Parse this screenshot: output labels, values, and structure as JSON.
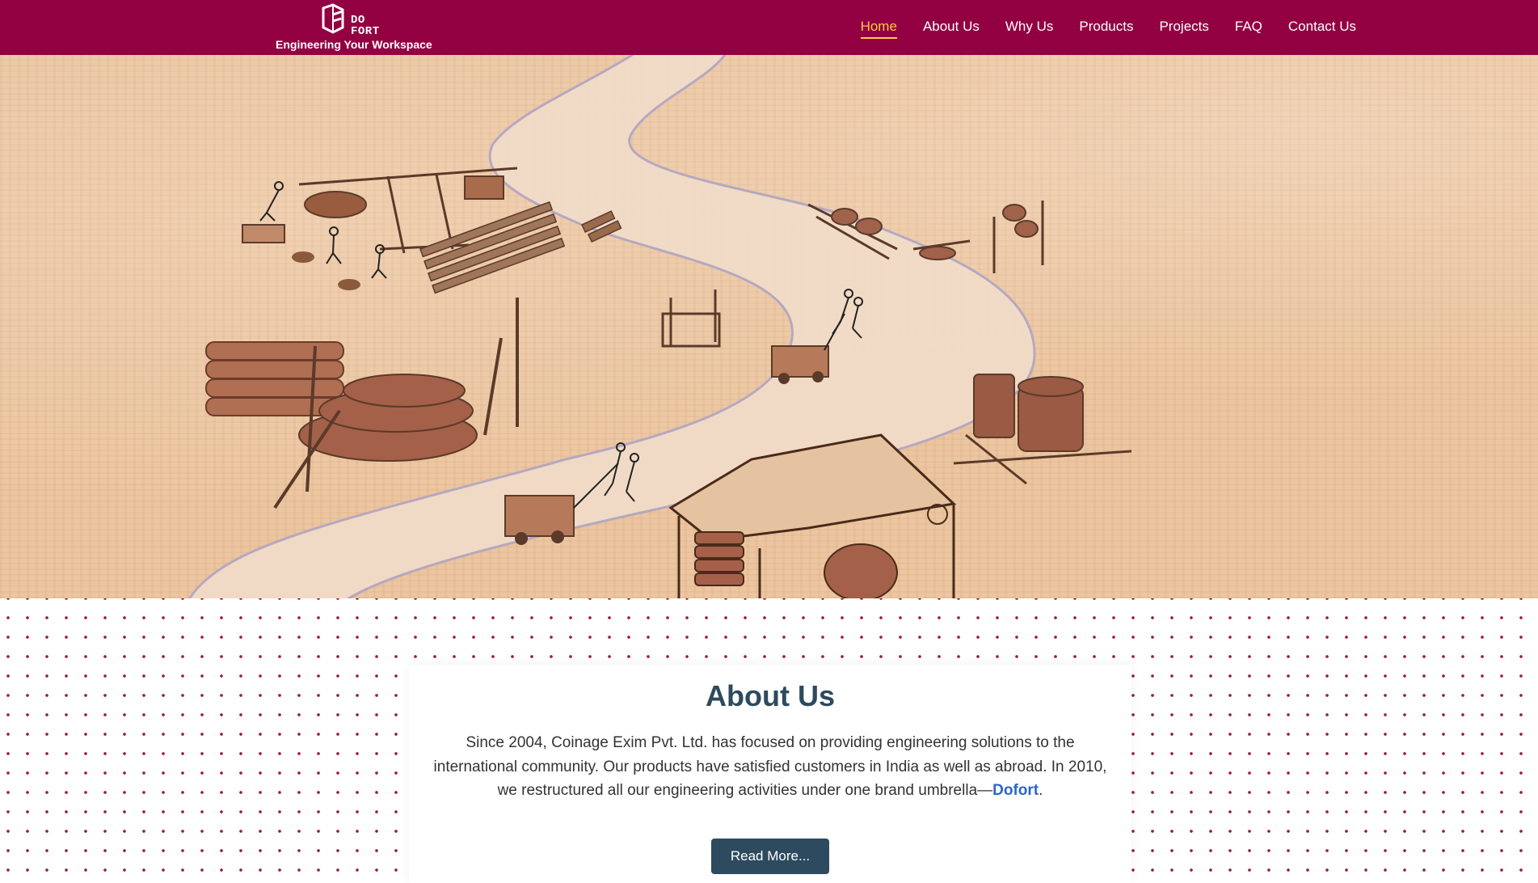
{
  "brand": {
    "logo_word_line1": "DO",
    "logo_word_line2": "FORT",
    "tagline": "Engineering Your Workspace"
  },
  "nav": {
    "items": [
      {
        "label": "Home",
        "active": true
      },
      {
        "label": "About Us",
        "active": false
      },
      {
        "label": "Why Us",
        "active": false
      },
      {
        "label": "Products",
        "active": false
      },
      {
        "label": "Projects",
        "active": false
      },
      {
        "label": "FAQ",
        "active": false
      },
      {
        "label": "Contact Us",
        "active": false
      }
    ]
  },
  "hero": {
    "image_alt": "hero-illustration"
  },
  "about": {
    "title": "About Us",
    "text_before": "Since 2004, Coinage Exim Pvt. Ltd. has focused on providing engineering solutions to the international community. Our products have satisfied customers in India as well as abroad. In 2010, we restructured all our engineering activities under one brand umbrella—",
    "brand_name": "Dofort",
    "text_after": ".",
    "button_label": "Read More..."
  },
  "colors": {
    "header_bg": "#930042",
    "nav_active": "#ffc845",
    "heading": "#2d4a5e",
    "link": "#2a66c8",
    "dot": "#9b1b4c"
  }
}
